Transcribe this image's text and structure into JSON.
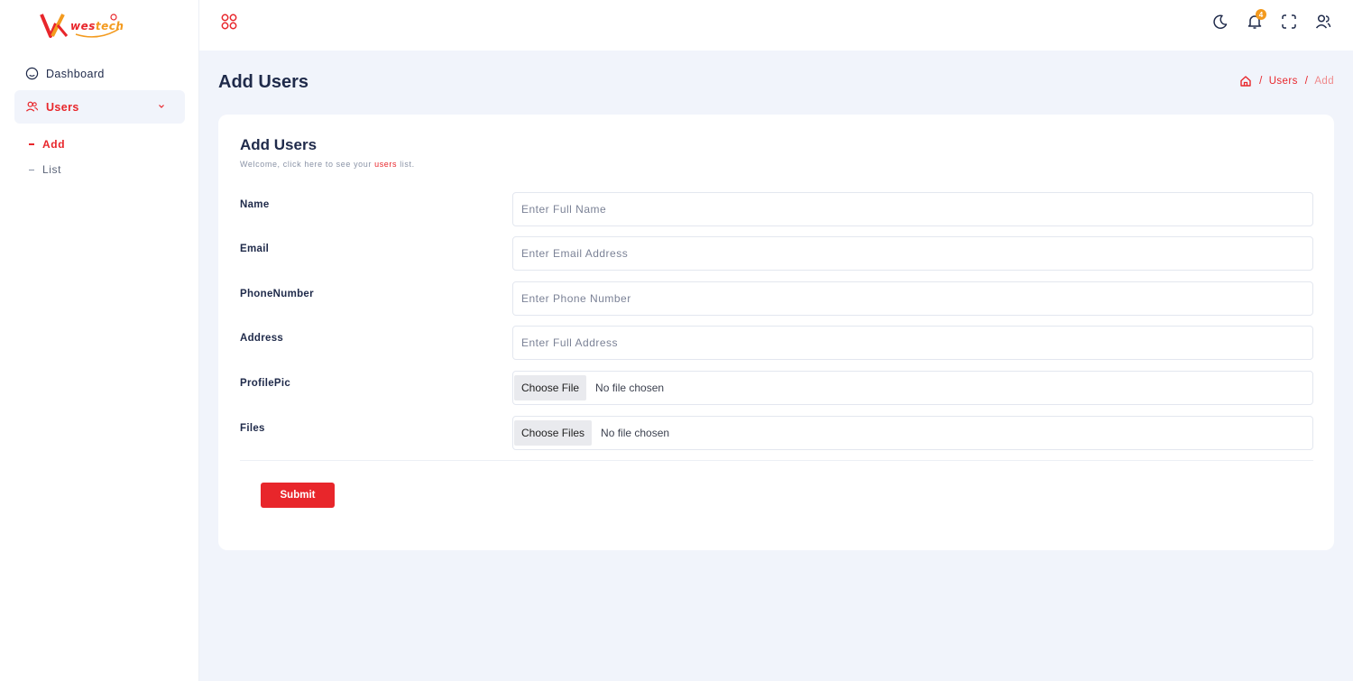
{
  "brand": {
    "logo_text_part1": "wes",
    "logo_text_part2": "tech",
    "primary_color": "#e8262b",
    "secondary_color": "#f39a1e"
  },
  "sidebar": {
    "items": [
      {
        "label": "Dashboard",
        "icon": "home-icon"
      },
      {
        "label": "Users",
        "icon": "users-icon",
        "expanded": true
      }
    ],
    "sub_items": [
      {
        "label": "Add",
        "active": true
      },
      {
        "label": "List",
        "active": false
      }
    ]
  },
  "header": {
    "icons": [
      "apps-icon",
      "moon-icon",
      "bell-icon",
      "fullscreen-icon",
      "user-icon"
    ],
    "notification_count": "4"
  },
  "page": {
    "title": "Add Users",
    "breadcrumb": {
      "sep": "/",
      "users": "Users",
      "add": "Add"
    }
  },
  "form": {
    "title": "Add Users",
    "subtitle_before": "Welcome, click here to see your ",
    "subtitle_link": "users",
    "subtitle_after": " list.",
    "fields": [
      {
        "label": "Name",
        "placeholder": "Enter Full Name"
      },
      {
        "label": "Email",
        "placeholder": "Enter Email Address"
      },
      {
        "label": "PhoneNumber",
        "placeholder": "Enter Phone Number"
      },
      {
        "label": "Address",
        "placeholder": "Enter Full Address"
      }
    ],
    "profile_pic": {
      "label": "ProfilePic",
      "button": "Choose File",
      "status": "No file chosen"
    },
    "files": {
      "label": "Files",
      "button": "Choose Files",
      "status": "No file chosen"
    },
    "submit_label": "Submit"
  }
}
